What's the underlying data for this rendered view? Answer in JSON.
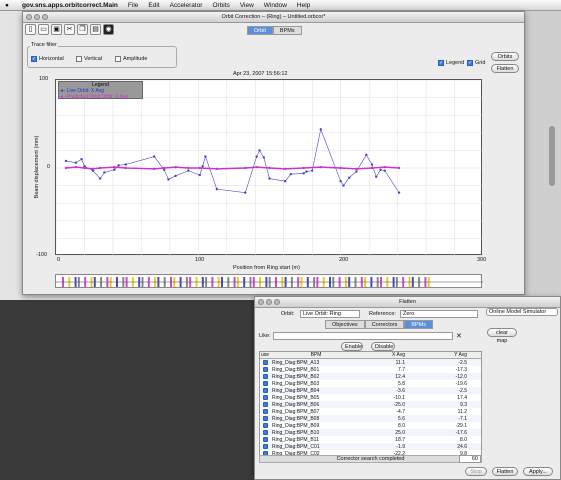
{
  "menubar": {
    "app": "gov.sns.apps.orbitcorrect.Main",
    "items": [
      "File",
      "Edit",
      "Accelerator",
      "Orbits",
      "View",
      "Window",
      "Help"
    ]
  },
  "main": {
    "title": "Orbit Correction – (Ring) – Untitled.orbcor*",
    "tabs": [
      "Orbit",
      "BPMs"
    ],
    "trace_filter": {
      "title": "Trace filter",
      "horizontal": "Horizontal",
      "vertical": "Vertical",
      "amplitude": "Amplitude"
    },
    "legend_chk": "Legend",
    "grid_chk": "Grid",
    "orbits_btn": "Orbits",
    "flatten_btn": "Flatten",
    "toolbar_icons": [
      "new-doc-icon",
      "open-icon",
      "save-icon",
      "cut-icon",
      "copy-icon",
      "paste-icon"
    ]
  },
  "chart_data": {
    "type": "line",
    "title": "Apr 23, 2007 15:56:12",
    "xlabel": "Position from Ring start (m)",
    "ylabel": "Beam displacement (mm)",
    "xlim": [
      0,
      300
    ],
    "ylim": [
      -100,
      100
    ],
    "xticks": [
      "0",
      "100",
      "200",
      "300"
    ],
    "yticks": [
      "100",
      "0",
      "-100"
    ],
    "legend": {
      "title": "Legend",
      "entries": [
        "Live Orbit: X Avg",
        "Predicted Orbit Orbit: X Avg"
      ]
    },
    "series": [
      {
        "name": "Live Orbit: X Avg",
        "color": "#4646c8",
        "x": [
          7,
          14,
          18,
          20,
          26,
          31,
          34,
          41,
          44,
          49,
          69,
          76,
          79,
          84,
          93,
          101,
          103,
          105,
          113,
          133,
          141,
          143,
          146,
          150,
          161,
          165,
          174,
          176,
          180,
          186,
          200,
          202,
          206,
          211,
          218,
          222,
          225,
          228,
          231,
          241
        ],
        "y": [
          8,
          6,
          10,
          2,
          -3,
          -12,
          -5,
          -2,
          3,
          4,
          13,
          -2,
          -13,
          -9,
          -3,
          -8,
          2,
          13,
          -24,
          -28,
          13,
          20,
          12,
          -12,
          -15,
          -7,
          -6,
          -4,
          -3,
          44,
          -15,
          -20,
          -11,
          -4,
          15,
          4,
          -10,
          -2,
          -3,
          -28
        ]
      },
      {
        "name": "Predicted Orbit Orbit: X Avg",
        "color": "#cc33cc",
        "x": [
          7,
          14,
          20,
          26,
          31,
          41,
          49,
          69,
          76,
          84,
          93,
          101,
          113,
          133,
          141,
          150,
          161,
          174,
          186,
          200,
          211,
          222,
          231,
          241
        ],
        "y": [
          0,
          1,
          0,
          -1,
          0,
          1,
          0,
          -1,
          0,
          1,
          0,
          0,
          -1,
          0,
          1,
          0,
          -1,
          0,
          1,
          0,
          -1,
          0,
          1,
          0
        ]
      }
    ]
  },
  "flatten": {
    "title": "Flatten",
    "orbit_label": "Orbit:",
    "orbit_value": "Live Orbit: Ring",
    "reference_label": "Reference:",
    "reference_value": "Zero",
    "simulator": "Online Model Simulator",
    "clear_map": "clear map",
    "tabs": [
      "Objectives",
      "Correctors",
      "BPMs"
    ],
    "like_label": "Like:",
    "enable_btn": "Enable",
    "disable_btn": "Disable",
    "table": {
      "headers": [
        "use",
        "BPM",
        "X Avg",
        "Y Avg"
      ],
      "rows": [
        [
          "Ring_Diag:BPM_A13",
          "11.1",
          "-2.5"
        ],
        [
          "Ring_Diag:BPM_B01",
          "7.7",
          "-17.3"
        ],
        [
          "Ring_Diag:BPM_B02",
          "12.4",
          "-12.0"
        ],
        [
          "Ring_Diag:BPM_B03",
          "5.8",
          "-19.6"
        ],
        [
          "Ring_Diag:BPM_B04",
          "-3.6",
          "-2.5"
        ],
        [
          "Ring_Diag:BPM_B05",
          "-10.1",
          "17.4"
        ],
        [
          "Ring_Diag:BPM_B06",
          "-25.0",
          "9.3"
        ],
        [
          "Ring_Diag:BPM_B07",
          "-4.7",
          "11.2"
        ],
        [
          "Ring_Diag:BPM_B08",
          "5.6",
          "-7.1"
        ],
        [
          "Ring_Diag:BPM_B09",
          "8.0",
          "-29.1"
        ],
        [
          "Ring_Diag:BPM_B10",
          "25.0",
          "-17.6"
        ],
        [
          "Ring_Diag:BPM_B11",
          "18.7",
          "8.0"
        ],
        [
          "Ring_Diag:BPM_C01",
          "-1.9",
          "24.6"
        ],
        [
          "Ring_Diag:BPM_C02",
          "-22.2",
          "9.8"
        ]
      ]
    },
    "status": "Corrector search completed",
    "count": "60",
    "stop_btn": "Stop",
    "flatten_btn": "Flatten",
    "apply_btn": "Apply..."
  }
}
